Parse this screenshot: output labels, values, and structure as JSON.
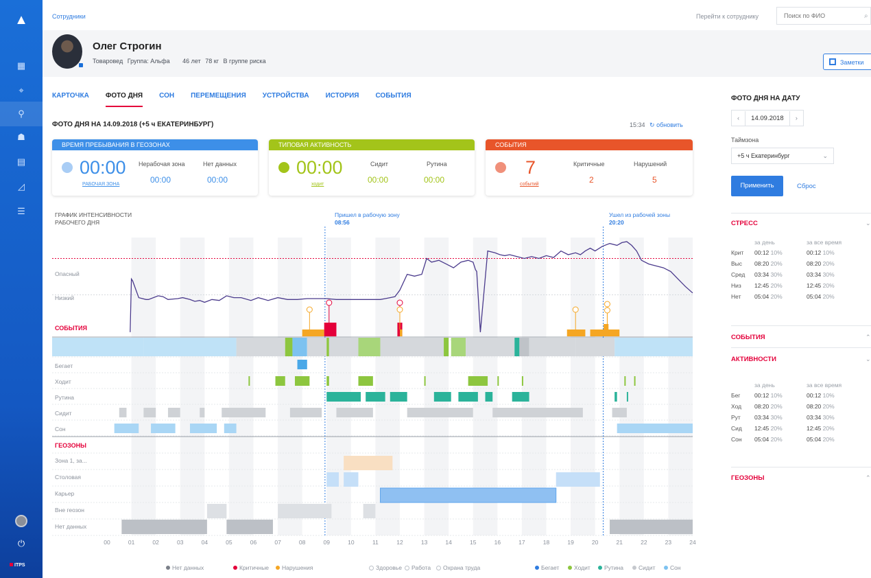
{
  "breadcrumb": "Сотрудники",
  "goto_label": "Перейти к сотруднику",
  "search_placeholder": "Поиск по ФИО",
  "employee": {
    "name": "Олег Строгин",
    "position": "Товаровед",
    "group": "Группа: Альфа",
    "age": "46 лет",
    "weight": "78 кг",
    "risk": "В группе риска"
  },
  "notes_label": "Заметки",
  "tabs": [
    "КАРТОЧКА",
    "ФОТО ДНЯ",
    "СОН",
    "ПЕРЕМЕЩЕНИЯ",
    "УСТРОЙСТВА",
    "ИСТОРИЯ",
    "СОБЫТИЯ"
  ],
  "active_tab": "ФОТО ДНЯ",
  "date_title": "ФОТО ДНЯ НА 14.09.2018 (+5 ч ЕКАТЕРИНБУРГ)",
  "time": "15:34",
  "refresh_label": "обновить",
  "cards": {
    "geo": {
      "title": "ВРЕМЯ ПРЕБЫВАНИЯ В ГЕОЗОНАХ",
      "big": "00:00",
      "sub": "РАБОЧАЯ ЗОНА",
      "l1": "Нерабочая зона",
      "v1": "00:00",
      "l2": "Нет данных",
      "v2": "00:00",
      "color": "#3d8fe8"
    },
    "activity": {
      "title": "ТИПОВАЯ АКТИВНОСТЬ",
      "big": "00:00",
      "sub": "ходит",
      "l1": "Сидит",
      "v1": "00:00",
      "l2": "Рутина",
      "v2": "00:00",
      "color": "#a3c41a"
    },
    "events": {
      "title": "СОБЫТИЯ",
      "big": "7",
      "sub": "событий",
      "l1": "Критичные",
      "v1": "2",
      "l2": "Нарушений",
      "v2": "5",
      "color": "#e8552a"
    }
  },
  "graph": {
    "title_line1": "ГРАФИК ИНТЕНСИВНОСТИ",
    "title_line2": "РАБОЧЕГО ДНЯ",
    "mark_in_label": "Пришел в рабочую зону",
    "mark_in_time": "08:56",
    "mark_out_label": "Ушел из рабочей зоны",
    "mark_out_time": "20:20",
    "level_danger": "Опасный",
    "level_low": "Низкий",
    "events_label": "СОБЫТИЯ",
    "activities_label": "АКТИВНОСТИ",
    "activity_rows": [
      "Бегает",
      "Ходит",
      "Рутина",
      "Сидит",
      "Сон"
    ],
    "geozones_label": "ГЕОЗОНЫ",
    "geozone_rows": [
      "Зона 1, за...",
      "Столовая",
      "Карьер",
      "Вне геозон",
      "Нет данных"
    ],
    "hours": [
      "00",
      "01",
      "02",
      "03",
      "04",
      "05",
      "06",
      "07",
      "08",
      "09",
      "10",
      "11",
      "12",
      "13",
      "14",
      "15",
      "16",
      "17",
      "18",
      "19",
      "20",
      "21",
      "22",
      "23",
      "24"
    ]
  },
  "chart_data": {
    "type": "line",
    "title": "ГРАФИК ИНТЕНСИВНОСТИ РАБОЧЕГО ДНЯ",
    "xlabel": "",
    "ylabel": "",
    "xlim": [
      0,
      24
    ],
    "ylim": [
      0,
      100
    ],
    "x_ticks": [
      "00",
      "01",
      "02",
      "03",
      "04",
      "05",
      "06",
      "07",
      "08",
      "09",
      "10",
      "11",
      "12",
      "13",
      "14",
      "15",
      "16",
      "17",
      "18",
      "19",
      "20",
      "21",
      "22",
      "23",
      "24"
    ],
    "thresholds": [
      {
        "label": "Опасный",
        "value": 82
      },
      {
        "label": "Низкий",
        "value": 43
      }
    ],
    "series": [
      {
        "x": [
          0.95,
          1.0,
          1.05,
          1.3,
          1.6,
          1.7,
          2.1,
          2.3,
          2.5,
          2.9,
          3.1,
          3.4,
          3.6,
          3.8,
          4.0,
          4.3,
          4.6,
          4.9,
          5.2,
          5.5,
          5.9,
          6.2,
          6.6,
          7.0,
          7.4,
          7.8,
          8.2,
          8.6,
          9.0,
          9.4,
          9.8,
          10.2,
          10.6,
          11.0,
          11.2,
          11.4,
          11.6,
          11.8,
          12.0,
          12.3,
          12.6,
          12.9,
          13.1,
          13.3,
          13.6,
          13.9,
          14.2,
          14.5,
          14.8,
          15.0,
          15.1,
          15.15,
          15.3,
          15.6,
          15.9,
          16.1,
          16.3,
          16.5,
          16.8,
          17.1,
          17.4,
          17.7,
          18.0,
          18.3,
          18.6,
          18.9,
          19.2,
          19.4,
          19.6,
          19.8,
          20.0,
          20.3,
          20.6,
          20.9,
          21.1,
          21.3,
          21.5,
          21.7,
          21.9,
          22.2,
          22.5,
          22.8,
          23.1,
          23.4,
          23.7,
          24.0
        ],
        "y": [
          3,
          60,
          58,
          40,
          38,
          38,
          42,
          41,
          38,
          39,
          40,
          38,
          36,
          37,
          35,
          38,
          37,
          42,
          40,
          40,
          37,
          40,
          37,
          40,
          38,
          38,
          39,
          39,
          39,
          38,
          38,
          38,
          38,
          38,
          38,
          39,
          40,
          41,
          48,
          65,
          63,
          65,
          82,
          78,
          80,
          76,
          72,
          78,
          80,
          78,
          70,
          68,
          3,
          90,
          88,
          86,
          85,
          86,
          84,
          82,
          84,
          82,
          85,
          83,
          90,
          86,
          88,
          86,
          90,
          93,
          90,
          95,
          98,
          96,
          99,
          100,
          96,
          90,
          80,
          76,
          74,
          72,
          68,
          60,
          52,
          45
        ]
      }
    ]
  },
  "legend": {
    "nodata": "Нет данных",
    "critical": "Критичные",
    "violations": "Нарушения",
    "health": "Здоровье",
    "work": "Работа",
    "safety": "Охрана труда",
    "run": "Бегает",
    "walk": "Ходит",
    "routine": "Рутина",
    "sit": "Сидит",
    "sleep": "Сон"
  },
  "right_panel": {
    "title": "ФОТО ДНЯ НА ДАТУ",
    "date": "14.09.2018",
    "tz_label": "Таймзона",
    "tz_value": "+5 ч Екатеринбург",
    "apply": "Применить",
    "reset": "Сброс",
    "stress_title": "СТРЕСС",
    "col_day": "за день",
    "col_all": "за все время",
    "stress": [
      {
        "k": "Крит",
        "d": "00:12",
        "dp": "10%",
        "a": "00:12",
        "ap": "10%"
      },
      {
        "k": "Выс",
        "d": "08:20",
        "dp": "20%",
        "a": "08:20",
        "ap": "20%"
      },
      {
        "k": "Сред",
        "d": "03:34",
        "dp": "30%",
        "a": "03:34",
        "ap": "30%"
      },
      {
        "k": "Низ",
        "d": "12:45",
        "dp": "20%",
        "a": "12:45",
        "ap": "20%"
      },
      {
        "k": "Нет",
        "d": "05:04",
        "dp": "20%",
        "a": "05:04",
        "ap": "20%"
      }
    ],
    "events_title": "СОБЫТИЯ",
    "activities_title": "АКТИВНОСТИ",
    "col_all2": "за все время",
    "activities": [
      {
        "k": "Бег",
        "d": "00:12",
        "dp": "10%",
        "a": "00:12",
        "ap": "10%"
      },
      {
        "k": "Ход",
        "d": "08:20",
        "dp": "20%",
        "a": "08:20",
        "ap": "20%"
      },
      {
        "k": "Рут",
        "d": "03:34",
        "dp": "30%",
        "a": "03:34",
        "ap": "30%"
      },
      {
        "k": "Сид",
        "d": "12:45",
        "dp": "20%",
        "a": "12:45",
        "ap": "20%"
      },
      {
        "k": "Сон",
        "d": "05:04",
        "dp": "20%",
        "a": "05:04",
        "ap": "20%"
      }
    ],
    "geozones_title": "ГЕОЗОНЫ"
  },
  "colors": {
    "accent": "#2f7ce0",
    "danger": "#e4003a",
    "violation": "#f5a623",
    "walk": "#8dc63f",
    "routine": "#2bb39a",
    "sit": "#cfd2d6",
    "sleep": "#a9d6f5",
    "run": "#4aa8e8"
  }
}
